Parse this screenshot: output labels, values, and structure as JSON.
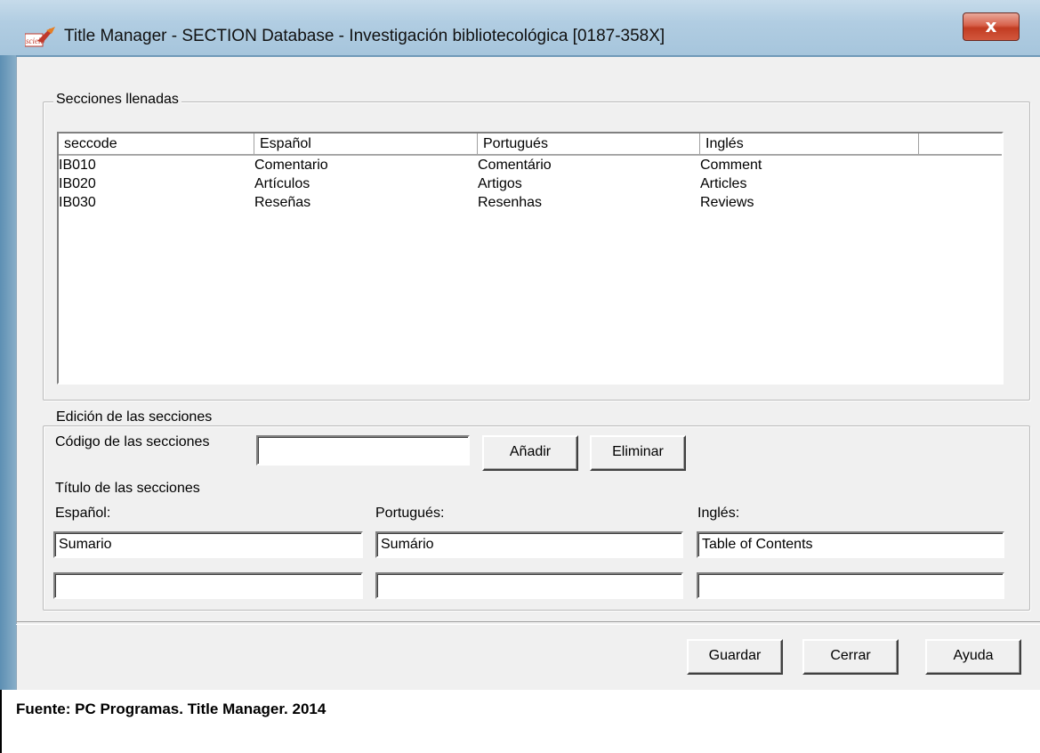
{
  "window": {
    "title": "Title Manager - SECTION Database - Investigación bibliotecológica [0187-358X]",
    "close_label": "x",
    "app_icon": "scielo-logo-icon"
  },
  "filled_sections": {
    "group_label": "Secciones llenadas",
    "columns": [
      "seccode",
      "Español",
      "Portugués",
      "Inglés"
    ],
    "rows": [
      {
        "seccode": "IB010",
        "es": "Comentario",
        "pt": "Comentário",
        "en": "Comment"
      },
      {
        "seccode": "IB020",
        "es": "Artículos",
        "pt": "Artigos",
        "en": "Articles"
      },
      {
        "seccode": "IB030",
        "es": "Reseñas",
        "pt": "Resenhas",
        "en": "Reviews"
      }
    ]
  },
  "edit_sections": {
    "group_label": "Edición de las secciones",
    "code_label": "Código de las secciones",
    "code_value": "",
    "add_button": "Añadir",
    "delete_button": "Eliminar",
    "title_label": "Título de las secciones",
    "spanish_label": "Español:",
    "portuguese_label": "Portugués:",
    "english_label": "Inglés:",
    "spanish_value": "Sumario",
    "portuguese_value": "Sumário",
    "english_value": "Table of Contents",
    "spanish_value_2": "",
    "portuguese_value_2": "",
    "english_value_2": ""
  },
  "footer_buttons": {
    "save": "Guardar",
    "close": "Cerrar",
    "help": "Ayuda"
  },
  "caption": "Fuente: PC Programas. Title Manager. 2014"
}
